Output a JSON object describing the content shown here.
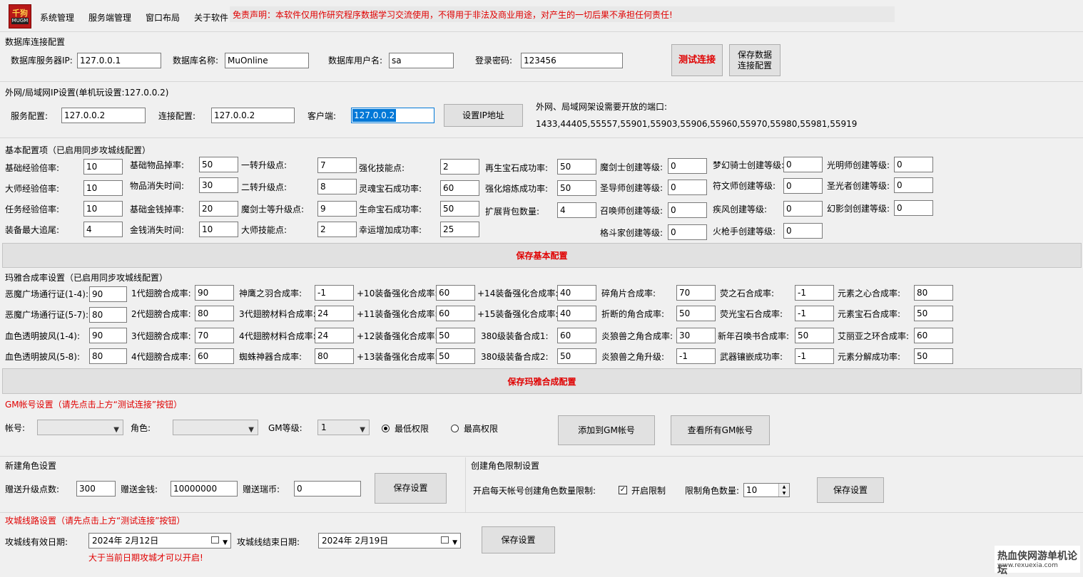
{
  "app": {
    "logo_top": "千狗",
    "logo_bottom": "MUGM",
    "menu": [
      "系统管理",
      "服务端管理",
      "窗口布局",
      "关于软件"
    ],
    "disclaimer": "免责声明：本软件仅用作研究程序数据学习交流使用，不得用于非法及商业用途，对产生的一切后果不承担任何责任!"
  },
  "db": {
    "title": "数据库连接配置",
    "labels": [
      "数据库服务器IP:",
      "数据库名称:",
      "数据库用户名:",
      "登录密码:"
    ],
    "values": [
      "127.0.0.1",
      "MuOnline",
      "sa",
      "123456"
    ],
    "test_btn": "测试连接",
    "save_btn": "保存数据\n连接配置"
  },
  "ip": {
    "title": "外网/局域网IP设置(单机玩设置:127.0.0.2)",
    "labels": [
      "服务配置:",
      "连接配置:",
      "客户端:"
    ],
    "values": [
      "127.0.0.2",
      "127.0.0.2",
      "127.0.0.2"
    ],
    "set_btn": "设置IP地址",
    "ports_title": "外网、局域网架设需要开放的端口:",
    "ports": "1433,44405,55557,55901,55903,55906,55960,55970,55980,55981,55919"
  },
  "basic": {
    "title": "基本配置项（已启用同步攻城线配置）",
    "fields": [
      {
        "label": "基础经验倍率:",
        "value": "10"
      },
      {
        "label": "大师经验倍率:",
        "value": "10"
      },
      {
        "label": "任务经验倍率:",
        "value": "10"
      },
      {
        "label": "装备最大追尾:",
        "value": "4"
      },
      {
        "label": "基础物品掉率:",
        "value": "50"
      },
      {
        "label": "物品消失时间:",
        "value": "30"
      },
      {
        "label": "基础金钱掉率:",
        "value": "20"
      },
      {
        "label": "金钱消失时间:",
        "value": "10"
      },
      {
        "label": "一转升级点:",
        "value": "7"
      },
      {
        "label": "二转升级点:",
        "value": "8"
      },
      {
        "label": "魔剑士等升级点:",
        "value": "9"
      },
      {
        "label": "大师技能点:",
        "value": "2"
      },
      {
        "label": "强化技能点:",
        "value": "2"
      },
      {
        "label": "灵魂宝石成功率:",
        "value": "60"
      },
      {
        "label": "生命宝石成功率:",
        "value": "50"
      },
      {
        "label": "幸运增加成功率:",
        "value": "25"
      },
      {
        "label": "再生宝石成功率:",
        "value": "50"
      },
      {
        "label": "强化熔炼成功率:",
        "value": "50"
      },
      {
        "label": "扩展背包数量:",
        "value": "4"
      },
      {
        "label": "魔剑士创建等级:",
        "value": "0"
      },
      {
        "label": "圣导师创建等级:",
        "value": "0"
      },
      {
        "label": "召唤师创建等级:",
        "value": "0"
      },
      {
        "label": "格斗家创建等级:",
        "value": "0"
      },
      {
        "label": "梦幻骑士创建等级:",
        "value": "0"
      },
      {
        "label": "符文师创建等级:",
        "value": "0"
      },
      {
        "label": "疾风创建等级:",
        "value": "0"
      },
      {
        "label": "火枪手创建等级:",
        "value": "0"
      },
      {
        "label": "光明师创建等级:",
        "value": "0"
      },
      {
        "label": "圣光者创建等级:",
        "value": "0"
      },
      {
        "label": "幻影剑创建等级:",
        "value": "0"
      }
    ],
    "save_btn": "保存基本配置"
  },
  "maya": {
    "title": "玛雅合成率设置（已启用同步攻城线配置）",
    "fields": [
      {
        "label": "恶魔广场通行证(1-4):",
        "value": "90"
      },
      {
        "label": "恶魔广场通行证(5-7):",
        "value": "80"
      },
      {
        "label": "血色透明披风(1-4):",
        "value": "90"
      },
      {
        "label": "血色透明披风(5-8):",
        "value": "80"
      },
      {
        "label": "1代翅膀合成率:",
        "value": "90"
      },
      {
        "label": "2代翅膀合成率:",
        "value": "80"
      },
      {
        "label": "3代翅膀合成率:",
        "value": "70"
      },
      {
        "label": "4代翅膀合成率:",
        "value": "60"
      },
      {
        "label": "神鹰之羽合成率:",
        "value": "-1"
      },
      {
        "label": "3代翅膀材料合成率:",
        "value": "24"
      },
      {
        "label": "4代翅膀材料合成率:",
        "value": "24"
      },
      {
        "label": "蜘蛛神器合成率:",
        "value": "80"
      },
      {
        "label": "+10装备强化合成率:",
        "value": "60"
      },
      {
        "label": "+11装备强化合成率:",
        "value": "60"
      },
      {
        "label": "+12装备强化合成率:",
        "value": "50"
      },
      {
        "label": "+13装备强化合成率:",
        "value": "50"
      },
      {
        "label": "+14装备强化合成率:",
        "value": "40"
      },
      {
        "label": "+15装备强化合成率:",
        "value": "40"
      },
      {
        "label": "380级装备合成1:",
        "value": "60"
      },
      {
        "label": "380级装备合成2:",
        "value": "50"
      },
      {
        "label": "碎角片合成率:",
        "value": "70"
      },
      {
        "label": "折断的角合成率:",
        "value": "50"
      },
      {
        "label": "炎狼兽之角合成率:",
        "value": "30"
      },
      {
        "label": "炎狼兽之角升级:",
        "value": "-1"
      },
      {
        "label": "荧之石合成率:",
        "value": "-1"
      },
      {
        "label": "荧光宝石合成率:",
        "value": "-1"
      },
      {
        "label": "新年召唤书合成率:",
        "value": "50"
      },
      {
        "label": "武器镶嵌成功率:",
        "value": "-1"
      },
      {
        "label": "元素之心合成率:",
        "value": "80"
      },
      {
        "label": "元素宝石合成率:",
        "value": "50"
      },
      {
        "label": "艾丽亚之环合成率:",
        "value": "60"
      },
      {
        "label": "元素分解成功率:",
        "value": "50"
      }
    ],
    "save_btn": "保存玛雅合成配置"
  },
  "gm": {
    "title": "GM帐号设置（请先点击上方“测试连接”按钮）",
    "account_label": "帐号:",
    "role_label": "角色:",
    "level_label": "GM等级:",
    "level_value": "1",
    "radio_low": "最低权限",
    "radio_high": "最高权限",
    "add_btn": "添加到GM帐号",
    "view_btn": "查看所有GM帐号"
  },
  "newrole": {
    "title": "新建角色设置",
    "labels": [
      "赠送升级点数:",
      "赠送金钱:",
      "赠送瑞币:"
    ],
    "values": [
      "300",
      "10000000",
      "0"
    ],
    "save_btn": "保存设置"
  },
  "limit": {
    "title": "创建角色限制设置",
    "desc": "开启每天帐号创建角色数量限制:",
    "check_label": "开启限制",
    "count_label": "限制角色数量:",
    "count_value": "10",
    "save_btn": "保存设置"
  },
  "siege": {
    "title": "攻城线路设置（请先点击上方“测试连接”按钮）",
    "start_label": "攻城线有效日期:",
    "start_value": "2024年  2月12日",
    "end_label": "攻城线结束日期:",
    "end_value": "2024年  2月19日",
    "save_btn": "保存设置",
    "note": "大于当前日期攻城才可以开启!"
  },
  "watermark": {
    "line1": "热血侠网游单机论坛",
    "line2": "www.rexuexia.com"
  },
  "colors": {
    "accent_red": "#e00000",
    "selection_blue": "#0078d7"
  }
}
